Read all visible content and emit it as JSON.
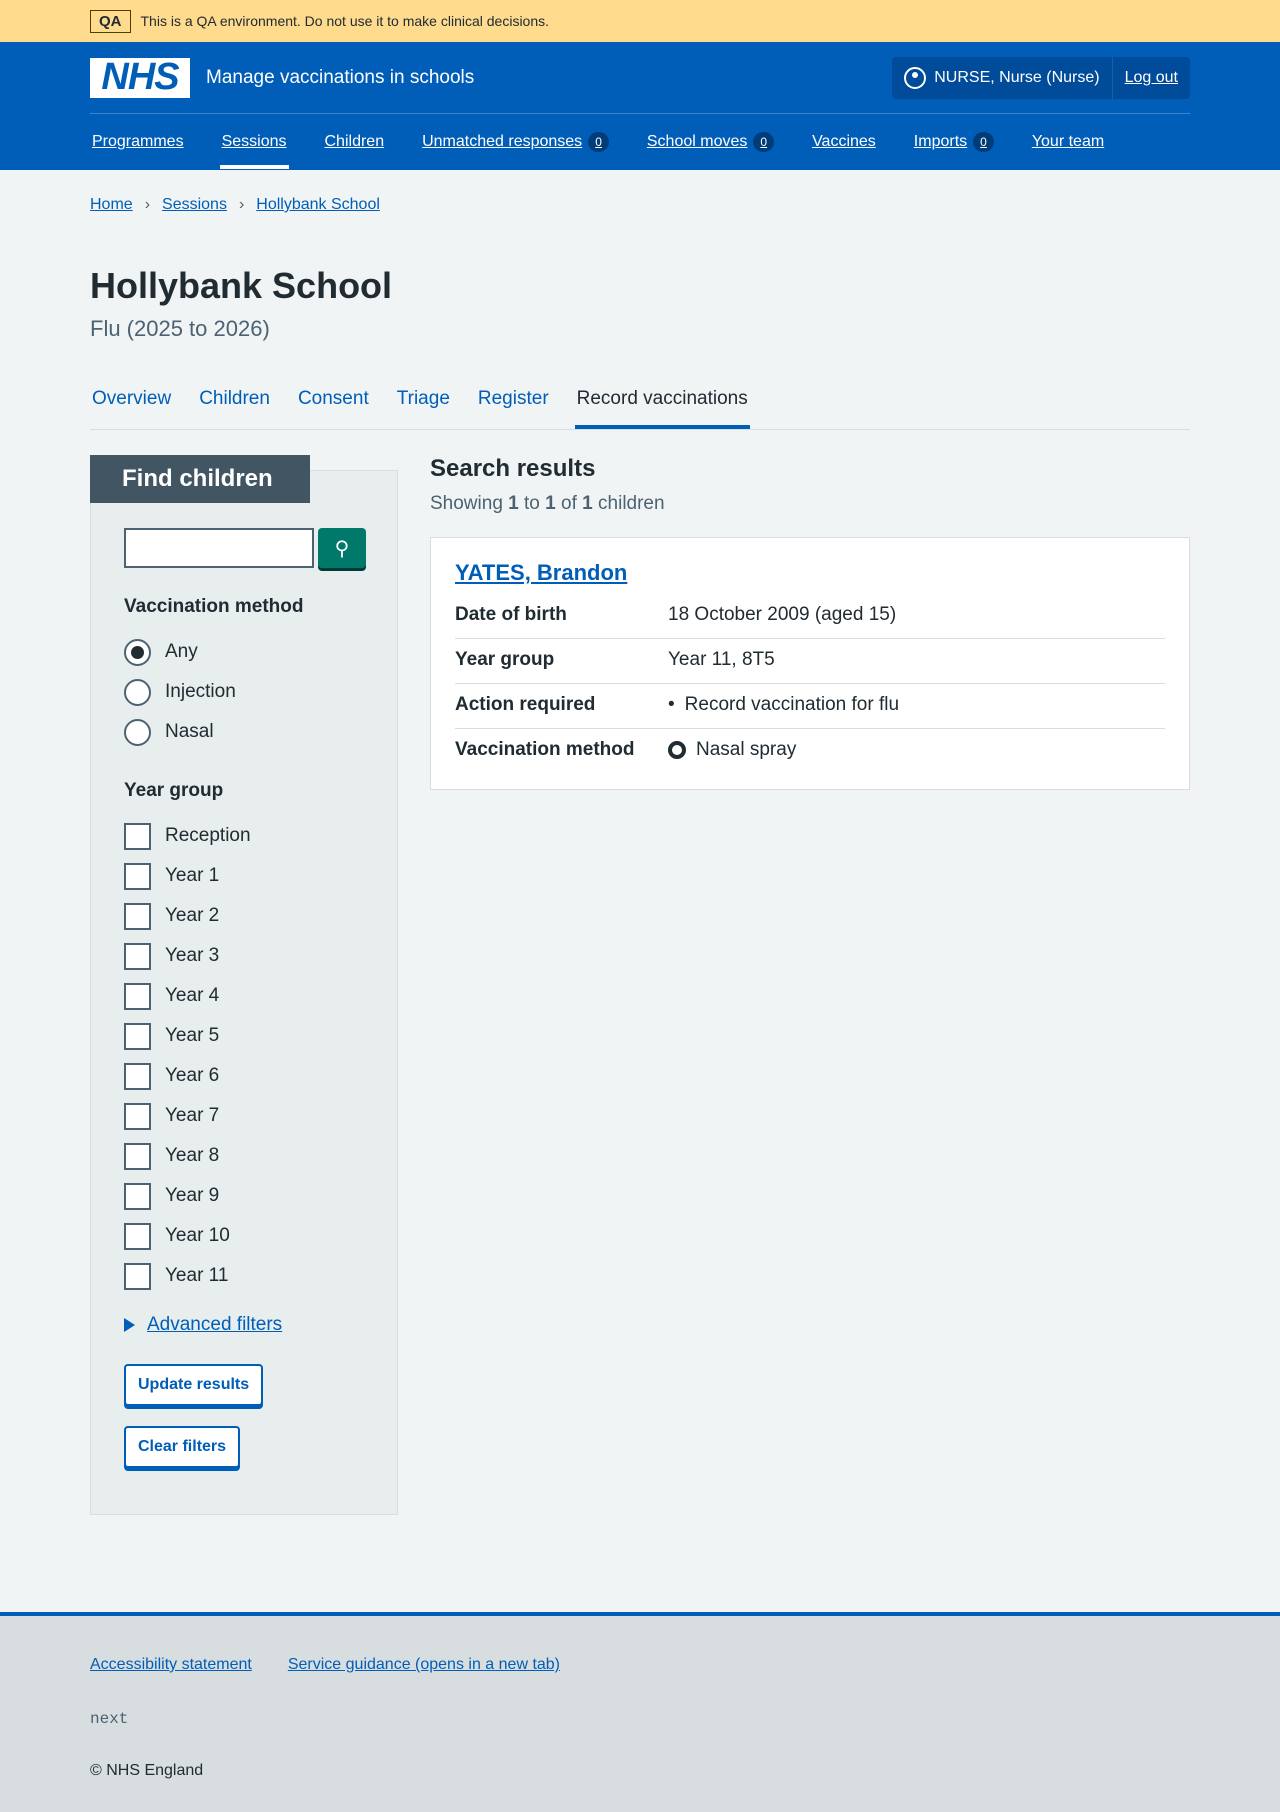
{
  "qa": {
    "tag": "QA",
    "message": "This is a QA environment. Do not use it to make clinical decisions."
  },
  "header": {
    "logo": "NHS",
    "service": "Manage vaccinations in schools",
    "user": "NURSE, Nurse (Nurse)",
    "logout": "Log out"
  },
  "nav": [
    {
      "label": "Programmes"
    },
    {
      "label": "Sessions"
    },
    {
      "label": "Children"
    },
    {
      "label": "Unmatched responses",
      "badge": "0"
    },
    {
      "label": "School moves",
      "badge": "0"
    },
    {
      "label": "Vaccines"
    },
    {
      "label": "Imports",
      "badge": "0"
    },
    {
      "label": "Your team"
    }
  ],
  "breadcrumb": [
    "Home",
    "Sessions",
    "Hollybank School"
  ],
  "page": {
    "title": "Hollybank School",
    "caption": "Flu (2025 to 2026)"
  },
  "tabs": [
    "Overview",
    "Children",
    "Consent",
    "Triage",
    "Register",
    "Record vaccinations"
  ],
  "filters": {
    "title": "Find children",
    "search_value": "",
    "method_label": "Vaccination method",
    "methods": [
      "Any",
      "Injection",
      "Nasal"
    ],
    "year_label": "Year group",
    "years": [
      "Reception",
      "Year 1",
      "Year 2",
      "Year 3",
      "Year 4",
      "Year 5",
      "Year 6",
      "Year 7",
      "Year 8",
      "Year 9",
      "Year 10",
      "Year 11"
    ],
    "advanced": "Advanced filters",
    "update": "Update results",
    "clear": "Clear filters"
  },
  "results": {
    "title": "Search results",
    "showing": "Showing",
    "from": "1",
    "to_word": "to",
    "to": "1",
    "of_word": "of",
    "total": "1",
    "suffix": "children",
    "child": {
      "name": "YATES, Brandon",
      "rows": [
        {
          "k": "Date of birth",
          "v": "18 October 2009 (aged 15)"
        },
        {
          "k": "Year group",
          "v": "Year 11, 8T5"
        },
        {
          "k": "Action required",
          "v": "Record vaccination for flu"
        },
        {
          "k": "Vaccination method",
          "v": "Nasal spray"
        }
      ]
    }
  },
  "footer": {
    "links": [
      "Accessibility statement",
      "Service guidance (opens in a new tab)"
    ],
    "version": "next",
    "copyright": "© NHS England"
  }
}
